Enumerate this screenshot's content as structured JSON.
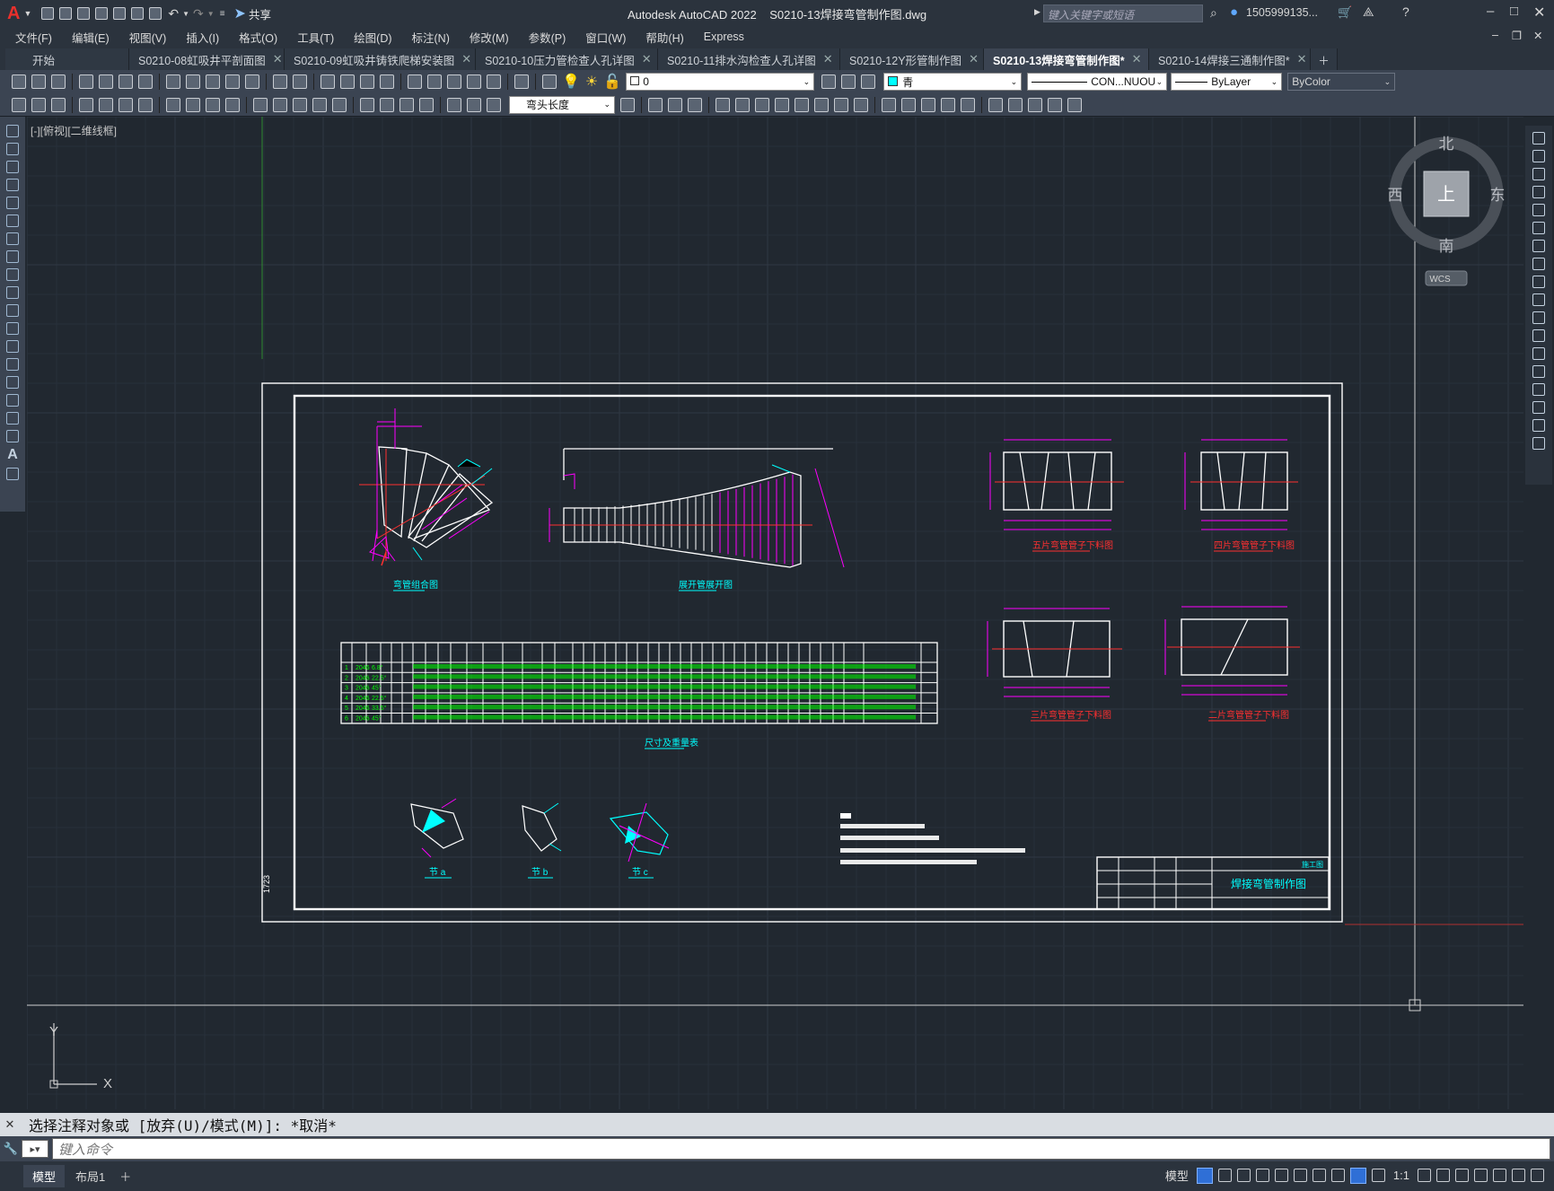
{
  "title_bar": {
    "app_title": "Autodesk AutoCAD 2022",
    "file_name": "S0210-13焊接弯管制作图.dwg",
    "share_label": "共享",
    "search_placeholder": "键入关键字或短语",
    "user_name": "1505999135...",
    "help_icon": "help-icon"
  },
  "menu": {
    "items": [
      "文件(F)",
      "编辑(E)",
      "视图(V)",
      "插入(I)",
      "格式(O)",
      "工具(T)",
      "绘图(D)",
      "标注(N)",
      "修改(M)",
      "参数(P)",
      "窗口(W)",
      "帮助(H)",
      "Express"
    ]
  },
  "tabs": [
    {
      "label": "开始"
    },
    {
      "label": "S0210-08虹吸井平剖面图"
    },
    {
      "label": "S0210-09虹吸井铸铁爬梯安装图"
    },
    {
      "label": "S0210-10压力管检查人孔详图"
    },
    {
      "label": "S0210-11排水沟检查人孔详图"
    },
    {
      "label": "S0210-12Y形管制作图"
    },
    {
      "label": "S0210-13焊接弯管制作图*"
    },
    {
      "label": "S0210-14焊接三通制作图*"
    }
  ],
  "toolbar": {
    "layer_value": "0",
    "color_value": "青",
    "linetype_value": "CON...NUOU",
    "lineweight_value": "ByLayer",
    "plotstyle_value": "ByColor",
    "dimstyle_value": "弯头长度"
  },
  "viewport": {
    "view_label": "[-][俯视][二维线框]",
    "viewcube": {
      "north": "北",
      "south": "南",
      "east": "东",
      "west": "西",
      "face": "上",
      "wcs": "WCS"
    },
    "ucs": {
      "x": "X",
      "y": "Y"
    }
  },
  "drawing": {
    "views": {
      "bend": "弯管组合图",
      "unfold": "展开管展开图",
      "five": "五片弯管管子下料图",
      "four": "四片弯管管子下料图",
      "three": "三片弯管管子下料图",
      "two": "二片弯管管子下料图",
      "table": "尺寸及重量表",
      "jointA": "节 a",
      "jointB": "节 b",
      "jointC": "节 c"
    },
    "title_block": {
      "drawing_name": "焊接弯管制作图",
      "phase": "施工图"
    },
    "table_rows": [
      {
        "vals": [
          "1",
          "2046",
          "6.8°"
        ]
      },
      {
        "vals": [
          "2",
          "2046",
          "22.5°"
        ]
      },
      {
        "vals": [
          "3",
          "2046",
          "45°"
        ]
      },
      {
        "vals": [
          "4",
          "2046",
          "22.5°"
        ]
      },
      {
        "vals": [
          "5",
          "2046",
          "33.5°"
        ]
      },
      {
        "vals": [
          "6",
          "2046",
          "45°"
        ]
      }
    ]
  },
  "command": {
    "history": "选择注释对象或 [放弃(U)/模式(M)]: *取消*",
    "placeholder": "键入命令"
  },
  "status": {
    "layout_tabs": [
      "模型",
      "布局1"
    ],
    "model_label": "模型",
    "scale": "1:1"
  },
  "colors": {
    "background": "#212830",
    "frame": "#ffffff",
    "dimension": "#ff00ff",
    "label": "#00ffff",
    "red_text": "#ff0000",
    "table_text": "#00ff00"
  }
}
